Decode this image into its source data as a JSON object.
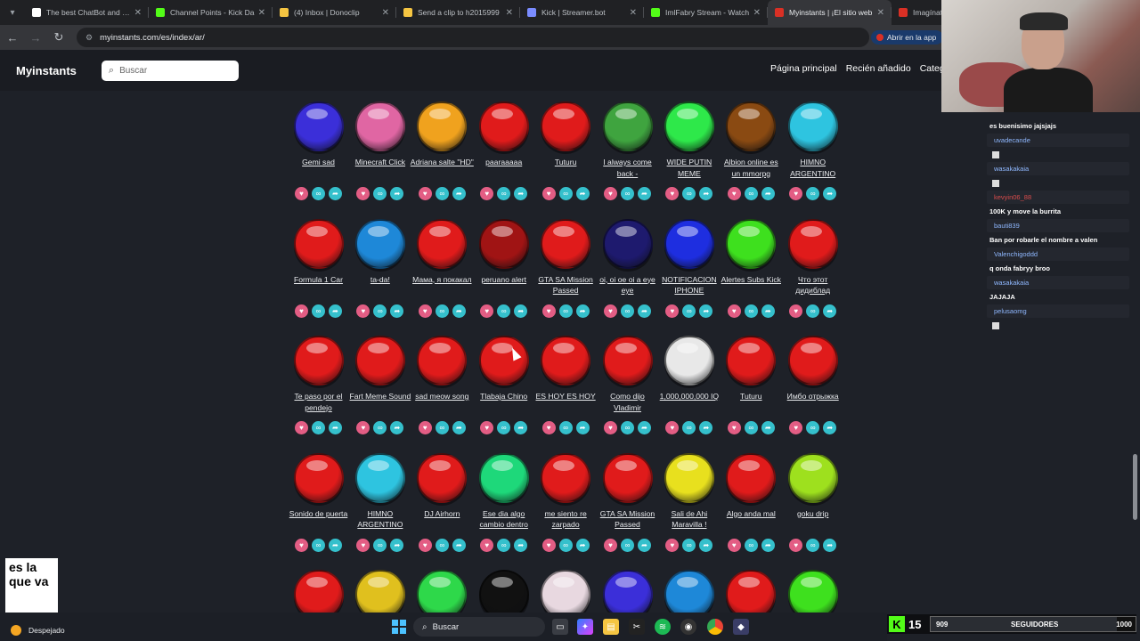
{
  "browser": {
    "tabs": [
      {
        "title": "The best ChatBot and Wi",
        "color": "#ffffff",
        "active": false
      },
      {
        "title": "Channel Points - Kick Da",
        "color": "#53fc18",
        "active": false
      },
      {
        "title": "(4) Inbox | Donoclip",
        "color": "#f5c542",
        "active": false
      },
      {
        "title": "Send a clip to h2015999",
        "color": "#f5c542",
        "active": false
      },
      {
        "title": "Kick | Streamer.bot",
        "color": "#7a8cff",
        "active": false
      },
      {
        "title": "ImlFabry Stream - Watch",
        "color": "#53fc18",
        "active": false
      },
      {
        "title": "Myinstants | ¡El sitio web",
        "color": "#d93025",
        "active": true
      },
      {
        "title": "Imagínate",
        "color": "#d93025",
        "active": false
      }
    ],
    "url": "myinstants.com/es/index/ar/",
    "open_app_label": "Abrir en la app"
  },
  "site": {
    "logo": "Myinstants",
    "search_placeholder": "Buscar",
    "nav": [
      "Página principal",
      "Recién añadido",
      "Categorías"
    ]
  },
  "instants": [
    [
      {
        "name": "Gemi sad",
        "color": "#3b2fd9"
      },
      {
        "name": "Minecraft Click",
        "color": "#e066a3"
      },
      {
        "name": "Adriana salte \"HD\"",
        "color": "#f0a21e"
      },
      {
        "name": "paaraaaaa",
        "color": "#e01b1b"
      },
      {
        "name": "Tuturu",
        "color": "#e01b1b"
      },
      {
        "name": "I always come back -",
        "color": "#3fa43f"
      },
      {
        "name": "WIDE PUTIN MEME",
        "color": "#2ee84a"
      },
      {
        "name": "Albion online es un mmorpg",
        "color": "#8a4a12"
      },
      {
        "name": "HIMNO ARGENTINO",
        "color": "#2ec4e0"
      }
    ],
    [
      {
        "name": "Formula 1 Car",
        "color": "#e01b1b"
      },
      {
        "name": "ta-da!",
        "color": "#1e88d8"
      },
      {
        "name": "Мама, я покакал",
        "color": "#e01b1b"
      },
      {
        "name": "peruano alert",
        "color": "#a01414"
      },
      {
        "name": "GTA SA Mission Passed",
        "color": "#e01b1b"
      },
      {
        "name": "oi, oi oe oi a eye eye",
        "color": "#1e1a6e"
      },
      {
        "name": "NOTIFICACION IPHONE",
        "color": "#1e2ee0"
      },
      {
        "name": "Alertes Subs Kick",
        "color": "#3ee01e"
      },
      {
        "name": "Что этот дидиблад",
        "color": "#e01b1b"
      }
    ],
    [
      {
        "name": "Te paso por el pendejo",
        "color": "#e01b1b"
      },
      {
        "name": "Fart Meme Sound",
        "color": "#e01b1b"
      },
      {
        "name": "sad meow song",
        "color": "#e01b1b"
      },
      {
        "name": "Tlabaja Chino",
        "color": "#e01b1b"
      },
      {
        "name": "ES HOY ES HOY",
        "color": "#e01b1b"
      },
      {
        "name": "Como dijo Vladimir",
        "color": "#e01b1b"
      },
      {
        "name": "1,000,000,000 IQ",
        "color": "#e8e8e8"
      },
      {
        "name": "Tuturu",
        "color": "#e01b1b"
      },
      {
        "name": "Имбо отрыжка",
        "color": "#e01b1b"
      }
    ],
    [
      {
        "name": "Sonido de puerta",
        "color": "#e01b1b"
      },
      {
        "name": "HIMNO ARGENTINO",
        "color": "#2ec4e0"
      },
      {
        "name": "DJ Airhorn",
        "color": "#e01b1b"
      },
      {
        "name": "Ese dia algo cambio dentro",
        "color": "#1ed87a"
      },
      {
        "name": "me siento re zarpado",
        "color": "#e01b1b"
      },
      {
        "name": "GTA SA Mission Passed",
        "color": "#e01b1b"
      },
      {
        "name": "Sali de Ahi Maravilla !",
        "color": "#e8e01e"
      },
      {
        "name": "Algo anda mal",
        "color": "#e01b1b"
      },
      {
        "name": "goku drip",
        "color": "#9ee01e"
      }
    ],
    [
      {
        "name": "",
        "color": "#e01b1b"
      },
      {
        "name": "",
        "color": "#e0c01e"
      },
      {
        "name": "",
        "color": "#2ed84a"
      },
      {
        "name": "",
        "color": "#111111"
      },
      {
        "name": "",
        "color": "#e8d8e0"
      },
      {
        "name": "",
        "color": "#3b2fd9"
      },
      {
        "name": "",
        "color": "#1e88d8"
      },
      {
        "name": "",
        "color": "#e01b1b"
      },
      {
        "name": "",
        "color": "#3ee01e"
      }
    ]
  ],
  "chat": [
    {
      "type": "text",
      "text": "es buenisimo jajsjajs"
    },
    {
      "type": "user",
      "text": "uvadecande",
      "red": false
    },
    {
      "type": "emote",
      "text": ""
    },
    {
      "type": "user",
      "text": "wasakakaia",
      "red": false
    },
    {
      "type": "emote",
      "text": ""
    },
    {
      "type": "user",
      "text": "kevyin06_88",
      "red": true
    },
    {
      "type": "text",
      "text": "100K y move la burrita"
    },
    {
      "type": "user",
      "text": "bauti839",
      "red": false
    },
    {
      "type": "text",
      "text": "Ban por robarle el nombre a valen"
    },
    {
      "type": "user",
      "text": "Valenchigoddd",
      "red": false
    },
    {
      "type": "text",
      "text": "q onda fabryy broo"
    },
    {
      "type": "user",
      "text": "wasakakaia",
      "red": false
    },
    {
      "type": "text",
      "text": "JAJAJA"
    },
    {
      "type": "user",
      "text": "pelusaomg",
      "red": false
    },
    {
      "type": "emote",
      "text": ""
    }
  ],
  "overlay_note": "es la que va",
  "kick_bar": {
    "count": "15",
    "current": "909",
    "label": "SEGUIDORES",
    "goal": "1000",
    "progress": 0.909
  },
  "taskbar": {
    "weather": "Despejado",
    "search_placeholder": "Buscar"
  }
}
